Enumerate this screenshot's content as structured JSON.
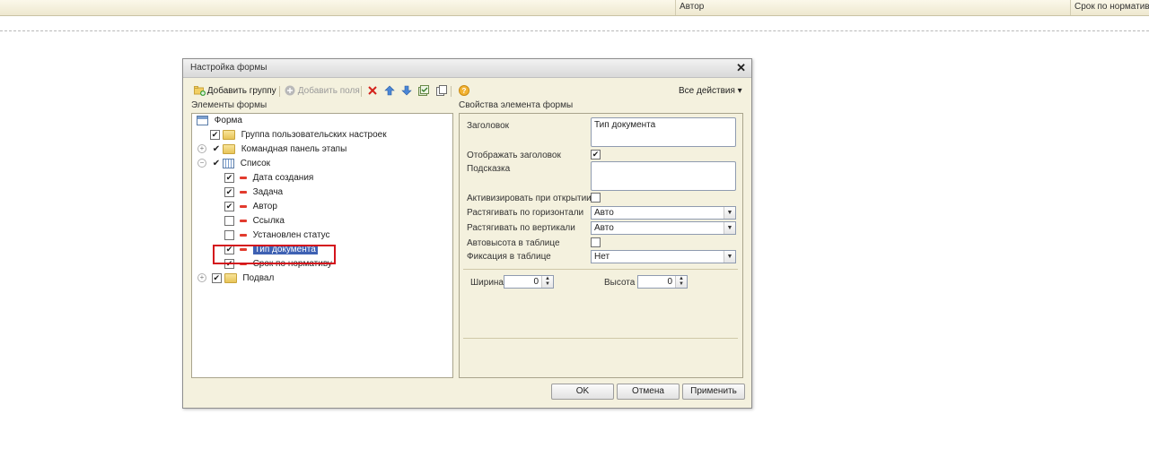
{
  "header": {
    "col_author": "Автор",
    "col_deadline": "Срок по нормативу"
  },
  "dialog": {
    "title": "Настройка формы",
    "toolbar": {
      "add_group": "Добавить группу",
      "add_fields": "Добавить поля",
      "all_actions": "Все действия ▾"
    },
    "left_section": "Элементы формы",
    "right_section": "Свойства элемента формы",
    "tree": {
      "root": "Форма",
      "group_user": "Группа пользовательских настроек",
      "cmd_panel": "Командная панель этапы",
      "list": "Список",
      "fields": {
        "created": "Дата создания",
        "task": "Задача",
        "author": "Автор",
        "link": "Ссылка",
        "status": "Установлен статус",
        "doctype": "Тип документа",
        "deadline": "Срок по нормативу"
      },
      "footer": "Подвал"
    },
    "props": {
      "title_label": "Заголовок",
      "title_value": "Тип документа",
      "show_title_label": "Отображать заголовок",
      "hint_label": "Подсказка",
      "hint_value": "",
      "activate_label": "Активизировать при открытии",
      "stretch_h_label": "Растягивать по горизонтали",
      "stretch_h_value": "Авто",
      "stretch_v_label": "Растягивать по вертикали",
      "stretch_v_value": "Авто",
      "autoheight_label": "Автовысота в таблице",
      "fixation_label": "Фиксация в таблице",
      "fixation_value": "Нет",
      "width_label": "Ширина",
      "width_value": "0",
      "height_label": "Высота",
      "height_value": "0"
    },
    "buttons": {
      "ok": "OK",
      "cancel": "Отмена",
      "apply": "Применить"
    }
  },
  "icons": [
    "add-group-icon",
    "add-fields-icon",
    "delete-icon",
    "move-up-icon",
    "move-down-icon",
    "check-all-icon",
    "copy-icon",
    "help-icon"
  ]
}
